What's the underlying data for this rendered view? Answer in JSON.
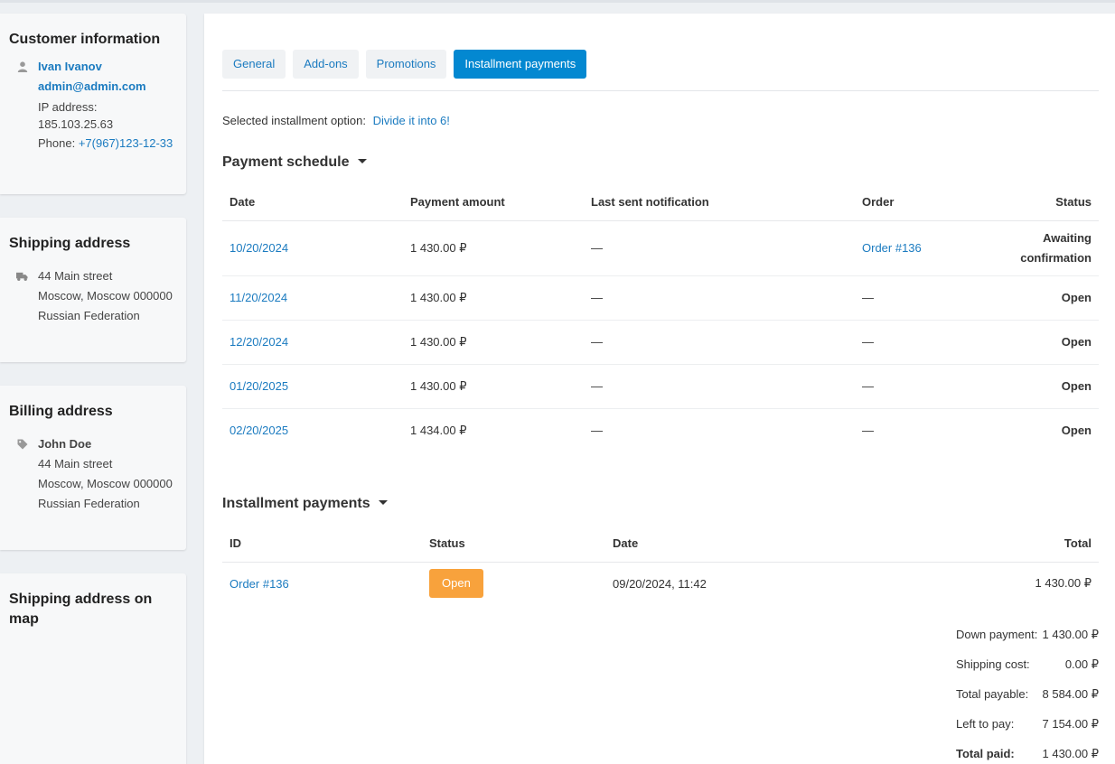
{
  "customer": {
    "title": "Customer information",
    "name": "Ivan Ivanov",
    "email": "admin@admin.com",
    "ip_label": "IP address:",
    "ip": "185.103.25.63",
    "phone_label": "Phone:",
    "phone": "+7(967)123-12-33"
  },
  "shipping": {
    "title": "Shipping address",
    "line1": "44 Main street",
    "line2": "Moscow, Moscow 000000",
    "line3": "Russian Federation"
  },
  "billing": {
    "title": "Billing address",
    "name": "John Doe",
    "line1": "44 Main street",
    "line2": "Moscow, Moscow 000000",
    "line3": "Russian Federation"
  },
  "map": {
    "title": "Shipping address on map"
  },
  "tabs": [
    "General",
    "Add-ons",
    "Promotions",
    "Installment payments"
  ],
  "selected_option": {
    "label": "Selected installment option:",
    "value": "Divide it into 6!"
  },
  "schedule": {
    "title": "Payment schedule",
    "headers": [
      "Date",
      "Payment amount",
      "Last sent notification",
      "Order",
      "Status"
    ],
    "rows": [
      {
        "date": "10/20/2024",
        "amount": "1 430.00 ₽",
        "notif": "—",
        "order": "Order #136",
        "status_line1": "Awaiting",
        "status_line2": "confirmation"
      },
      {
        "date": "11/20/2024",
        "amount": "1 430.00 ₽",
        "notif": "—",
        "order": "—",
        "status": "Open"
      },
      {
        "date": "12/20/2024",
        "amount": "1 430.00 ₽",
        "notif": "—",
        "order": "—",
        "status": "Open"
      },
      {
        "date": "01/20/2025",
        "amount": "1 430.00 ₽",
        "notif": "—",
        "order": "—",
        "status": "Open"
      },
      {
        "date": "02/20/2025",
        "amount": "1 434.00 ₽",
        "notif": "—",
        "order": "—",
        "status": "Open"
      }
    ]
  },
  "payments": {
    "title": "Installment payments",
    "headers": [
      "ID",
      "Status",
      "Date",
      "Total"
    ],
    "rows": [
      {
        "id": "Order #136",
        "status": "Open",
        "date": "09/20/2024, 11:42",
        "total": "1 430.00 ₽"
      }
    ]
  },
  "totals": {
    "down_label": "Down payment:",
    "down": "1 430.00 ₽",
    "ship_label": "Shipping cost:",
    "ship": "0.00 ₽",
    "payable_label": "Total payable:",
    "payable": "8 584.00 ₽",
    "left_label": "Left to pay:",
    "left": "7 154.00 ₽",
    "paid_label": "Total paid:",
    "paid": "1 430.00 ₽"
  },
  "colors": {
    "accent": "#0388d1",
    "link": "#1b7bc0",
    "badge_open": "#f8a23c"
  },
  "icons": {
    "customer": "user-icon",
    "shipping": "truck-icon",
    "billing": "tag-icon"
  }
}
